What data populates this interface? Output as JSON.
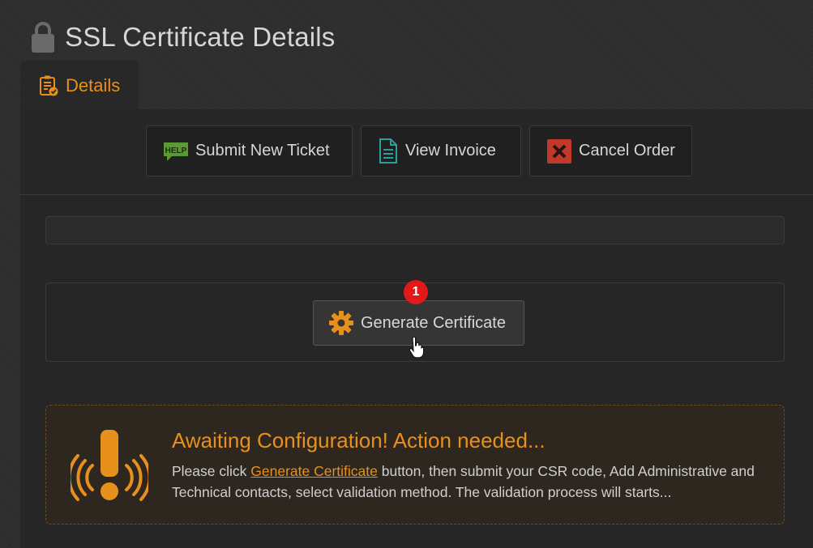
{
  "page": {
    "title": "SSL Certificate Details",
    "title_icon": "lock-icon"
  },
  "tabs": [
    {
      "label": "Details",
      "icon": "clipboard-check-icon",
      "active": true
    }
  ],
  "toolbar": {
    "submit_ticket": {
      "label": "Submit New Ticket",
      "icon": "help-icon",
      "icon_text": "HELP"
    },
    "view_invoice": {
      "label": "View Invoice",
      "icon": "document-icon"
    },
    "cancel_order": {
      "label": "Cancel Order",
      "icon": "cancel-x-icon"
    }
  },
  "generate": {
    "label": "Generate Certificate",
    "icon": "gear-icon",
    "badge": "1"
  },
  "alert": {
    "title": "Awaiting Configuration! Action needed...",
    "text_before": "Please click ",
    "link": "Generate Certificate",
    "text_after": " button, then submit your CSR code, Add Administrative and Technical contacts, select validation method. The validation process will starts...",
    "icon": "alert-exclamation-icon"
  },
  "colors": {
    "accent": "#e8901c",
    "help_green": "#5a9a32",
    "cancel_red": "#c0392b",
    "doc_teal": "#2aa198",
    "badge_red": "#e41818"
  }
}
